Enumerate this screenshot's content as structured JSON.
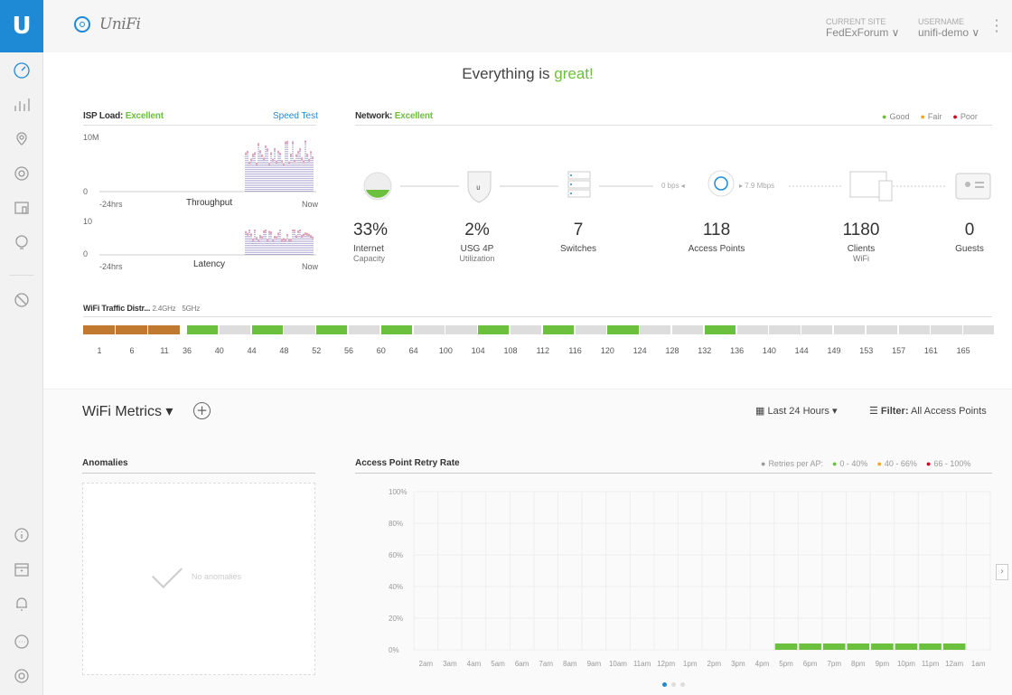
{
  "app": {
    "logo": "U",
    "brand": "UniFi"
  },
  "topbar": {
    "site_label": "CURRENT SITE",
    "site_value": "FedExForum ∨",
    "user_label": "USERNAME",
    "user_value": "unifi-demo ∨"
  },
  "sidebar": {
    "items": [
      "dashboard-icon",
      "statistics-icon",
      "map-icon",
      "devices-icon",
      "clients-icon",
      "insights-icon",
      "security-icon"
    ],
    "bottom": [
      "info-icon",
      "calendar-icon",
      "bell-icon",
      "chat-icon",
      "settings-icon"
    ]
  },
  "headline": {
    "prefix": "Everything is ",
    "status": "great!"
  },
  "isp": {
    "title": "ISP Load: ",
    "status": "Excellent",
    "speed_test": "Speed Test",
    "throughput": {
      "ymax": "10M",
      "ymin": "0",
      "start": "-24hrs",
      "label": "Throughput",
      "end": "Now"
    },
    "latency": {
      "ymax": "10",
      "ymin": "0",
      "start": "-24hrs",
      "label": "Latency",
      "end": "Now"
    }
  },
  "network": {
    "title": "Network: ",
    "status": "Excellent",
    "legend": [
      "Good",
      "Fair",
      "Poor"
    ],
    "rate_down": "0 bps ◂",
    "rate_up": "▸ 7.9 Mbps",
    "stats": [
      {
        "n": "33%",
        "l1": "Internet",
        "l2": "Capacity"
      },
      {
        "n": "2%",
        "l1": "USG 4P",
        "l2": "Utilization"
      },
      {
        "n": "7",
        "l1": "Switches",
        "l2": ""
      },
      {
        "n": "118",
        "l1": "Access Points",
        "l2": ""
      },
      {
        "n": "1180",
        "l1": "Clients",
        "l2": "WiFi"
      },
      {
        "n": "0",
        "l1": "Guests",
        "l2": ""
      }
    ]
  },
  "wifi_dist": {
    "title": "WiFi Traffic Distr...",
    "band24": "2.4GHz",
    "band5": "5GHz",
    "ch24": [
      "1",
      "6",
      "11"
    ],
    "ch5": [
      "36",
      "40",
      "44",
      "48",
      "52",
      "56",
      "60",
      "64",
      "100",
      "104",
      "108",
      "112",
      "116",
      "120",
      "124",
      "128",
      "132",
      "136",
      "140",
      "144",
      "149",
      "153",
      "157",
      "161",
      "165"
    ],
    "active5": [
      "36",
      "44",
      "52",
      "60",
      "104",
      "112",
      "120",
      "132"
    ]
  },
  "metrics": {
    "title": "WiFi Metrics ▾",
    "range": "Last 24 Hours ▾",
    "filter_label": "Filter:",
    "filter_value": "All Access Points"
  },
  "anomalies": {
    "title": "Anomalies",
    "empty": "No anomalies"
  },
  "retry": {
    "title": "Access Point Retry Rate",
    "legend_label": "Retries per AP:",
    "legend": [
      "0 - 40%",
      "40 - 66%",
      "66 - 100%"
    ],
    "colors": {
      "good": "#6bc03d",
      "fair": "#f5a623",
      "poor": "#d0021b"
    }
  },
  "chart_data": {
    "type": "bar",
    "title": "Access Point Retry Rate",
    "categories": [
      "2am",
      "3am",
      "4am",
      "5am",
      "6am",
      "7am",
      "8am",
      "9am",
      "10am",
      "11am",
      "12pm",
      "1pm",
      "2pm",
      "3pm",
      "4pm",
      "5pm",
      "6pm",
      "7pm",
      "8pm",
      "9pm",
      "10pm",
      "11pm",
      "12am",
      "1am"
    ],
    "y_ticks": [
      "100%",
      "80%",
      "60%",
      "40%",
      "20%",
      "0%"
    ],
    "ylim": [
      0,
      100
    ],
    "values": [
      0,
      0,
      0,
      0,
      0,
      0,
      0,
      0,
      0,
      0,
      0,
      0,
      0,
      0,
      0,
      2,
      2,
      2,
      2,
      2,
      2,
      2,
      2,
      0
    ],
    "grid": true
  }
}
